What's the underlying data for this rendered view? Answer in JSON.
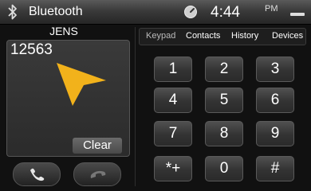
{
  "status_bar": {
    "title": "Bluetooth",
    "time": "4:44",
    "ampm": "PM",
    "bluetooth_icon": "bluetooth-icon",
    "clock_icon": "clock-icon",
    "minimize_icon": "minimize-icon"
  },
  "dialer": {
    "contact_name": "JENS",
    "number": "12563",
    "clear_label": "Clear",
    "arrow_color": "#f2b21b",
    "call_icon": "phone-call-icon",
    "end_icon": "phone-hangup-icon"
  },
  "tabs": [
    {
      "label": "Keypad"
    },
    {
      "label": "Contacts"
    },
    {
      "label": "History"
    },
    {
      "label": "Devices"
    }
  ],
  "keypad": [
    "1",
    "2",
    "3",
    "4",
    "5",
    "6",
    "7",
    "8",
    "9",
    "*+",
    "0",
    "#"
  ]
}
